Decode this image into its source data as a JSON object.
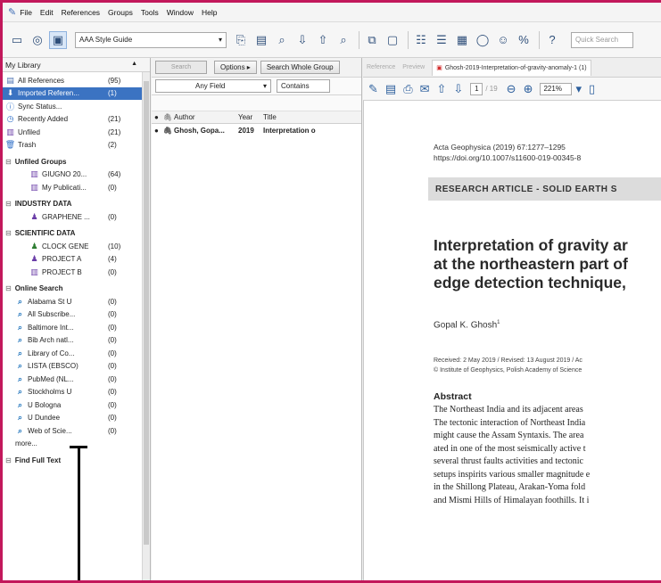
{
  "menu": [
    "File",
    "Edit",
    "References",
    "Groups",
    "Tools",
    "Window",
    "Help"
  ],
  "toolbar": {
    "output_style": "AAA Style Guide",
    "quick_search_placeholder": "Quick Search"
  },
  "library": {
    "header": "My Library",
    "items": [
      {
        "label": "All References",
        "count": "(95)",
        "icon": "library-icon"
      },
      {
        "label": "Imported Referen...",
        "count": "(1)",
        "icon": "import-icon",
        "selected": true
      },
      {
        "label": "Sync Status...",
        "count": "",
        "icon": "sync-icon"
      },
      {
        "label": "Recently Added",
        "count": "(21)",
        "icon": "clock-icon"
      },
      {
        "label": "Unfiled",
        "count": "(21)",
        "icon": "unfiled-icon"
      },
      {
        "label": "Trash",
        "count": "(2)",
        "icon": "trash-icon"
      }
    ],
    "groups": [
      {
        "title": "Unfiled Groups",
        "items": [
          {
            "label": "GIUGNO 20...",
            "count": "(64)",
            "icon": "group-icon"
          },
          {
            "label": "My Publicati...",
            "count": "(0)",
            "icon": "group-icon"
          }
        ]
      },
      {
        "title": "INDUSTRY DATA",
        "items": [
          {
            "label": "GRAPHENE ...",
            "count": "(0)",
            "icon": "smart-group-icon"
          }
        ]
      },
      {
        "title": "SCIENTIFIC DATA",
        "items": [
          {
            "label": "CLOCK GENE",
            "count": "(10)",
            "icon": "smart-group-icon"
          },
          {
            "label": "PROJECT A",
            "count": "(4)",
            "icon": "smart-group-icon"
          },
          {
            "label": "PROJECT B",
            "count": "(0)",
            "icon": "group-icon"
          }
        ]
      },
      {
        "title": "Online Search",
        "items": [
          {
            "label": "Alabama St U",
            "count": "(0)",
            "icon": "online-search-icon"
          },
          {
            "label": "All Subscribe...",
            "count": "(0)",
            "icon": "online-search-icon"
          },
          {
            "label": "Baltimore Int...",
            "count": "(0)",
            "icon": "online-search-icon"
          },
          {
            "label": "Bib Arch natl...",
            "count": "(0)",
            "icon": "online-search-icon"
          },
          {
            "label": "Library of Co...",
            "count": "(0)",
            "icon": "online-search-icon"
          },
          {
            "label": "LISTA (EBSCO)",
            "count": "(0)",
            "icon": "online-search-icon"
          },
          {
            "label": "PubMed (NL...",
            "count": "(0)",
            "icon": "online-search-icon"
          },
          {
            "label": "Stockholms U",
            "count": "(0)",
            "icon": "online-search-icon"
          },
          {
            "label": "U Bologna",
            "count": "(0)",
            "icon": "online-search-icon"
          },
          {
            "label": "U Dundee",
            "count": "(0)",
            "icon": "online-search-icon"
          },
          {
            "label": "Web of Scie...",
            "count": "(0)",
            "icon": "online-search-icon"
          }
        ]
      }
    ],
    "more": "more...",
    "find_full_text": "Find Full Text"
  },
  "search": {
    "tab_search": "Search",
    "options": "Options ▸",
    "scope": "Search Whole Group",
    "field": "Any Field",
    "operator": "Contains"
  },
  "columns": {
    "author": "Author",
    "year": "Year",
    "title": "Title"
  },
  "references": [
    {
      "author": "Ghosh, Gopa...",
      "year": "2019",
      "title": "Interpretation o"
    }
  ],
  "tabs": {
    "reference": "Reference",
    "preview": "Preview",
    "pdf": "Ghosh-2019-Interpretation-of-gravity-anomaly-1 (1)"
  },
  "pdf_toolbar": {
    "page": "1",
    "total": "/ 19",
    "zoom": "221%"
  },
  "paper": {
    "journal_line1": "Acta Geophysica (2019) 67:1277–1295",
    "journal_line2": "https://doi.org/10.1007/s11600-019-00345-8",
    "banner": "RESEARCH ARTICLE - SOLID EARTH S",
    "title_line1": "Interpretation of gravity ar",
    "title_line2": "at the northeastern part of",
    "title_line3": "edge detection technique,",
    "author": "Gopal K. Ghosh",
    "author_sup": "1",
    "received_line1": "Received: 2 May 2019 / Revised: 13 August 2019 / Ac",
    "received_line2": "© Institute of Geophysics, Polish Academy of Science",
    "abstract_heading": "Abstract",
    "abstract_lines": [
      "The Northeast India and its adjacent areas",
      "The tectonic interaction of Northeast India",
      "might cause the Assam Syntaxis. The area",
      "ated in one of the most seismically active t",
      "several thrust faults activities and tectonic",
      "setups inspirits various smaller magnitude e",
      "in the Shillong Plateau, Arakan-Yoma fold",
      "and Mismi Hills of Himalayan foothills. It i"
    ]
  },
  "colors": {
    "frame": "#c2185b",
    "selection": "#3b73c2"
  }
}
